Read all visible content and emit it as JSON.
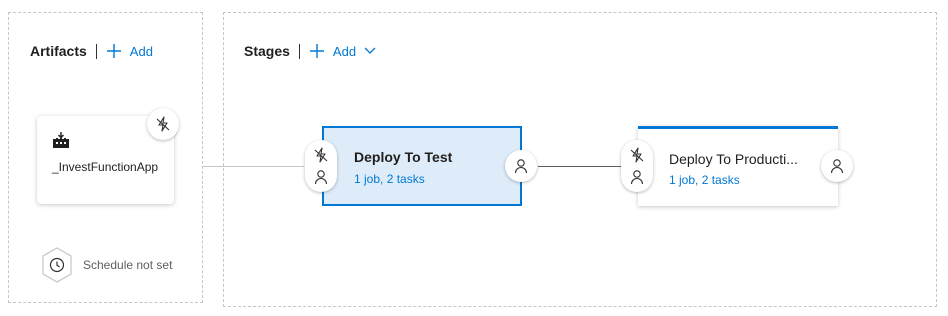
{
  "artifacts": {
    "title": "Artifacts",
    "add_label": "Add",
    "items": [
      {
        "name": "_InvestFunctionApp",
        "icon": "build-pipeline-icon"
      }
    ],
    "schedule_label": "Schedule not set"
  },
  "stages": {
    "title": "Stages",
    "add_label": "Add",
    "items": [
      {
        "name": "Deploy To Test",
        "summary": "1 job, 2 tasks",
        "selected": true
      },
      {
        "name": "Deploy To Producti...",
        "summary": "1 job, 2 tasks",
        "selected": false
      }
    ]
  },
  "colors": {
    "accent": "#0078d4",
    "selected_bg": "#deecf9",
    "connector": "#605e5c"
  }
}
